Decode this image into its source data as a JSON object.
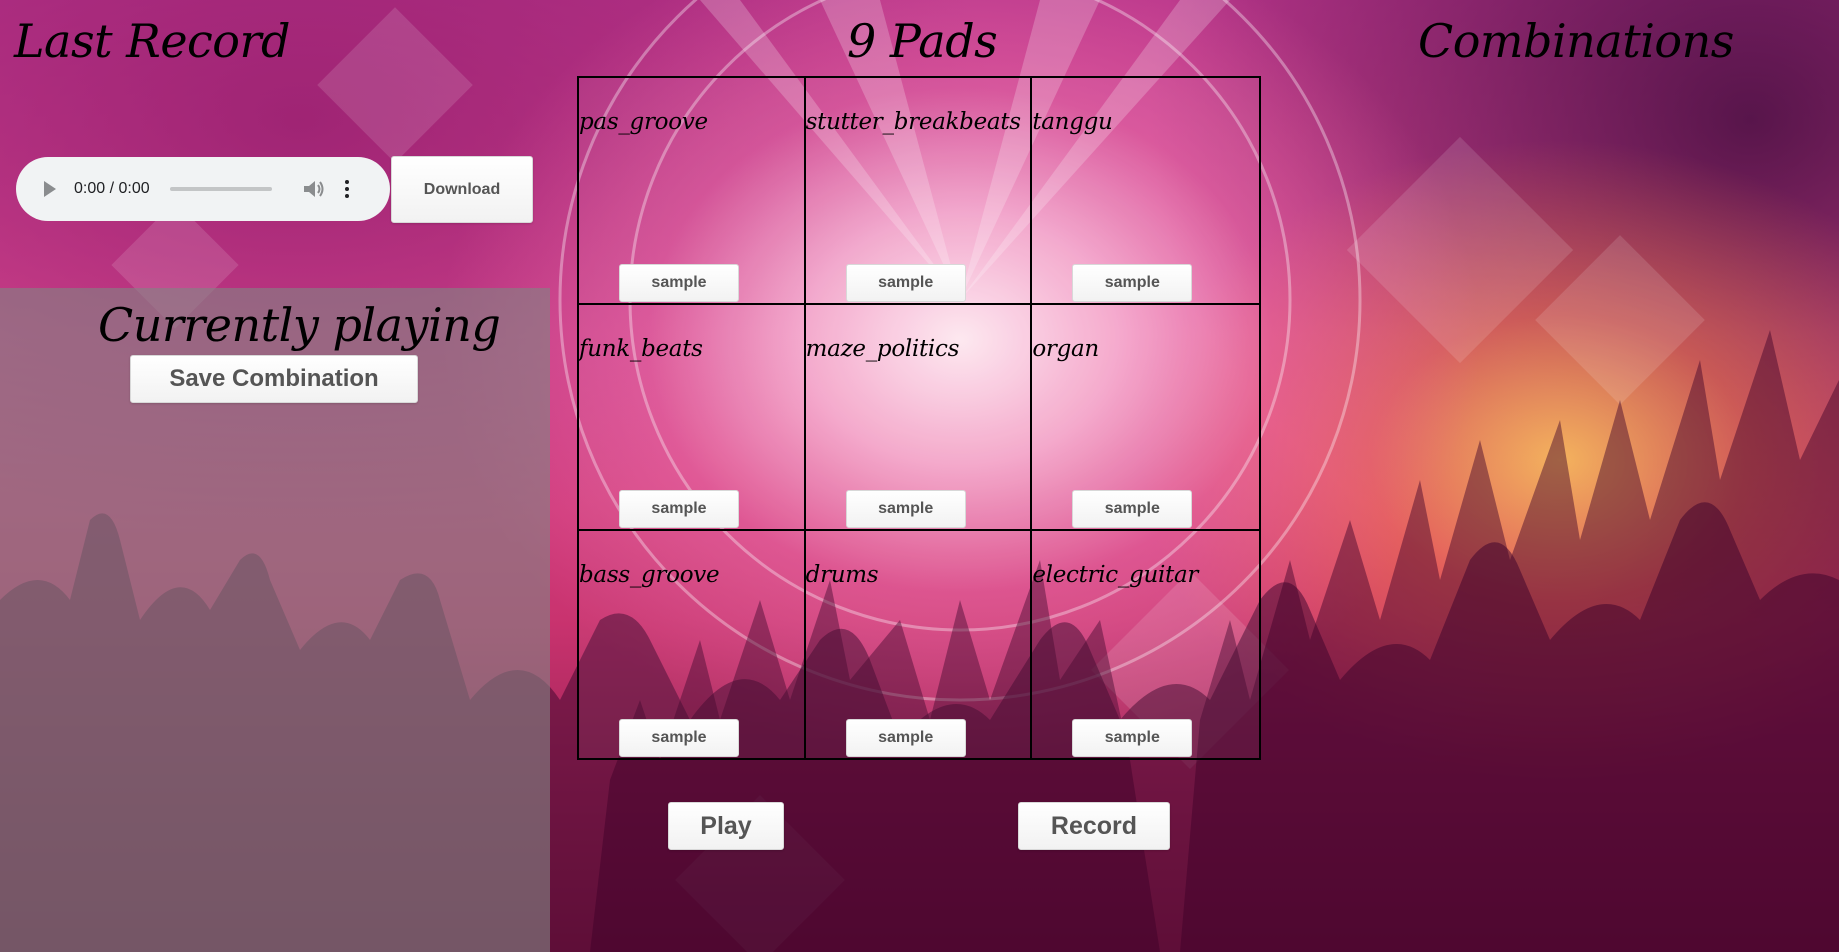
{
  "headings": {
    "last_record": "Last Record",
    "pads": "9 Pads",
    "combinations": "Combinations",
    "currently_playing": "Currently playing"
  },
  "audio_player": {
    "time": "0:00 / 0:00",
    "play_icon": "play-icon",
    "volume_icon": "volume-icon",
    "more_icon": "more-vertical-icon"
  },
  "buttons": {
    "download": "Download",
    "save_combination": "Save Combination",
    "play": "Play",
    "record": "Record"
  },
  "pads": [
    {
      "name": "pas_groove",
      "sample_label": "sample"
    },
    {
      "name": "stutter_breakbeats",
      "sample_label": "sample"
    },
    {
      "name": "tanggu",
      "sample_label": "sample"
    },
    {
      "name": "funk_beats",
      "sample_label": "sample"
    },
    {
      "name": "maze_politics",
      "sample_label": "sample"
    },
    {
      "name": "organ",
      "sample_label": "sample"
    },
    {
      "name": "bass_groove",
      "sample_label": "sample"
    },
    {
      "name": "drums",
      "sample_label": "sample"
    },
    {
      "name": "electric_guitar",
      "sample_label": "sample"
    }
  ],
  "colors": {
    "background_primary": "#c9336f",
    "background_highlight": "#ffe6f0",
    "left_panel": "#828282",
    "grid_border": "#000000"
  }
}
